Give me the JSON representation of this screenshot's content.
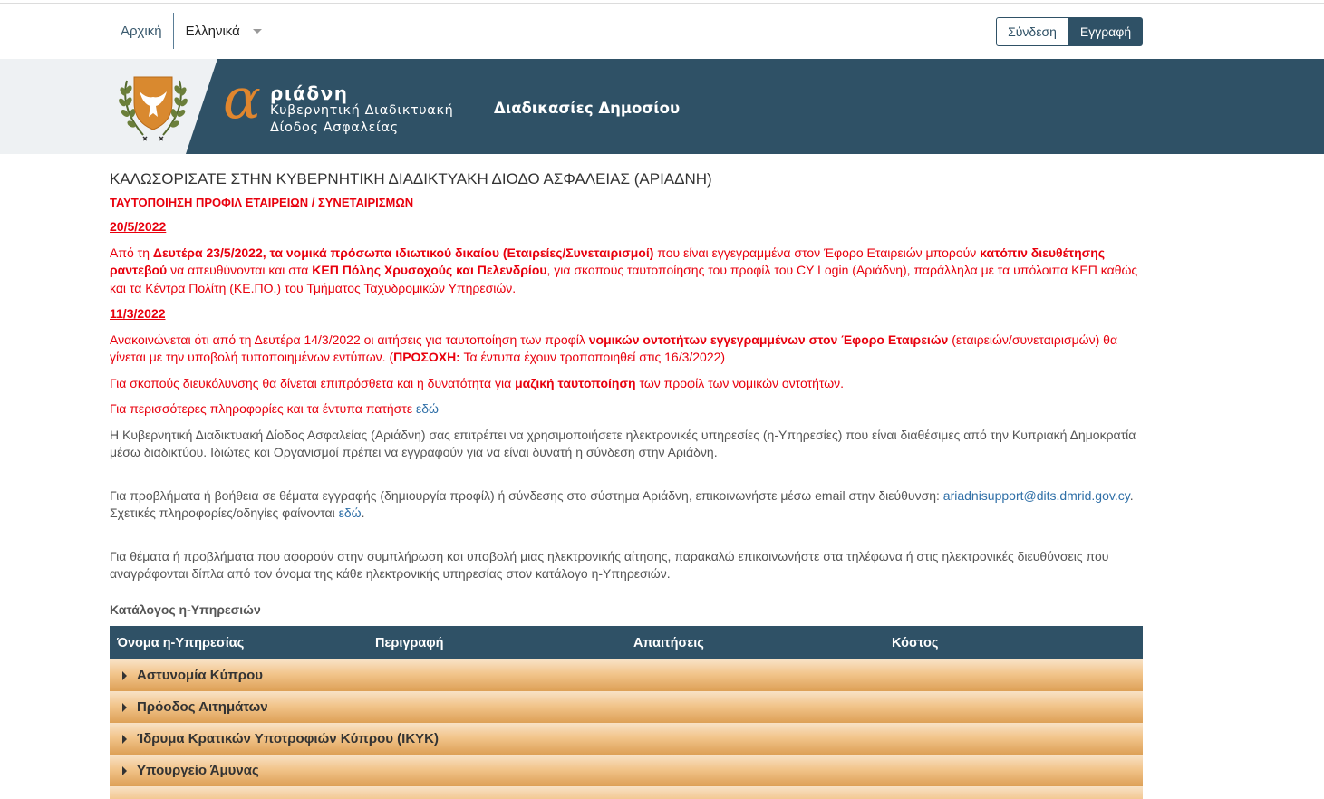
{
  "nav": {
    "home": "Αρχική",
    "language": "Ελληνικά"
  },
  "auth": {
    "login": "Σύνδεση",
    "register": "Εγγραφή"
  },
  "banner": {
    "logo_letter": "α",
    "logo_name": "ριάδνη",
    "logo_sub1": "Κυβερνητική Διαδικτυακή",
    "logo_sub2": "Δίοδος Ασφαλείας",
    "section_title": "Διαδικασίες Δημοσίου"
  },
  "content": {
    "welcome": "ΚΑΛΩΣΟΡΙΣΑΤΕ ΣΤΗΝ ΚΥΒΕΡΝΗΤΙΚΗ ΔΙΑΔΙΚΤΥΑΚΗ ΔΙΟΔΟ ΑΣΦΑΛΕΙΑΣ (ΑΡΙΑΔΝΗ)",
    "subhead": "ΤΑΥΤΟΠΟΙΗΣΗ ΠΡΟΦΙΛ ΕΤΑΙΡΕΙΩΝ / ΣΥΝΕΤΑΙΡΙΣΜΩΝ",
    "date1": "20/5/2022",
    "p1": {
      "a": "Από τη ",
      "b": "Δευτέρα 23/5/2022, τα νομικά πρόσωπα ιδιωτικού δικαίου (Εταιρείες/Συνεταιρισμοί)",
      "c": " που είναι εγγεγραμμένα στον Έφορο Εταιρειών μπορούν ",
      "d": "κατόπιν διευθέτησης ραντεβού",
      "e": " να απευθύνονται και στα ",
      "f": "ΚΕΠ Πόλης Χρυσοχούς και Πελενδρίου",
      "g": ", για σκοπούς ταυτοποίησης του προφίλ του CY Login (Αριάδνη), παράλληλα με τα υπόλοιπα ΚΕΠ καθώς και τα Κέντρα Πολίτη (ΚΕ.ΠΟ.) του Τμήματος Ταχυδρομικών Υπηρεσιών."
    },
    "date2": "11/3/2022",
    "p2": {
      "a": "Ανακοινώνεται ότι από τη Δευτέρα 14/3/2022 οι αιτήσεις για ταυτοποίηση των προφίλ ",
      "b": "νομικών οντοτήτων εγγεγραμμένων στον Έφορο Εταιρειών",
      "c": " (εταιρειών/συνεταιρισμών) θα γίνεται με την υποβολή τυποποιημένων εντύπων. (",
      "d": "ΠΡΟΣΟΧΗ:",
      "e": " Τα έντυπα έχουν τροποποιηθεί στις 16/3/2022)"
    },
    "p3": {
      "a": "Για σκοπούς διευκόλυνσης θα δίνεται επιπρόσθετα και η δυνατότητα για ",
      "b": "μαζική ταυτοποίηση",
      "c": " των προφίλ των νομικών οντοτήτων."
    },
    "p4": {
      "a": "Για περισσότερες πληροφορίες και τα έντυπα πατήστε ",
      "link": "εδώ"
    },
    "p5": "Η Κυβερνητική Διαδικτυακή Δίοδος Ασφαλείας (Αριάδνη) σας επιτρέπει να χρησιμοποιήσετε ηλεκτρονικές υπηρεσίες (η-Υπηρεσίες) που είναι διαθέσιμες από την Κυπριακή Δημοκρατία μέσω διαδικτύου. Ιδιώτες και Οργανισμοί πρέπει να εγγραφούν για να είναι δυνατή η σύνδεση στην Αριάδνη.",
    "p6": {
      "a": "Για προβλήματα ή βοήθεια σε θέματα εγγραφής (δημιουργία προφίλ) ή σύνδεσης στο σύστημα Αριάδνη, επικοινωνήστε μέσω email στην διεύθυνση: ",
      "email": "ariadnisupport@dits.dmrid.gov.cy",
      "b": ". Σχετικές πληροφορίες/οδηγίες φαίνονται ",
      "link": "εδώ",
      "c": "."
    },
    "p7": "Για θέματα ή προβλήματα που αφορούν στην συμπλήρωση και υποβολή μιας ηλεκτρονικής αίτησης, παρακαλώ επικοινωνήστε στα τηλέφωνα ή στις ηλεκτρονικές διευθύνσεις που αναγράφονται δίπλα από τον όνομα της κάθε ηλεκτρονικής υπηρεσίας στον κατάλογο η-Υπηρεσιών.",
    "catalog_title": "Κατάλογος η-Υπηρεσιών"
  },
  "table": {
    "headers": [
      "Όνομα η-Υπηρεσίας",
      "Περιγραφή",
      "Απαιτήσεις",
      "Κόστος"
    ],
    "rows": [
      "Αστυνομία Κύπρου",
      "Πρόοδος Αιτημάτων",
      "Ίδρυμα Κρατικών Υποτροφιών Κύπρου (ΙΚΥΚ)",
      "Υπουργείο Άμυνας"
    ]
  }
}
